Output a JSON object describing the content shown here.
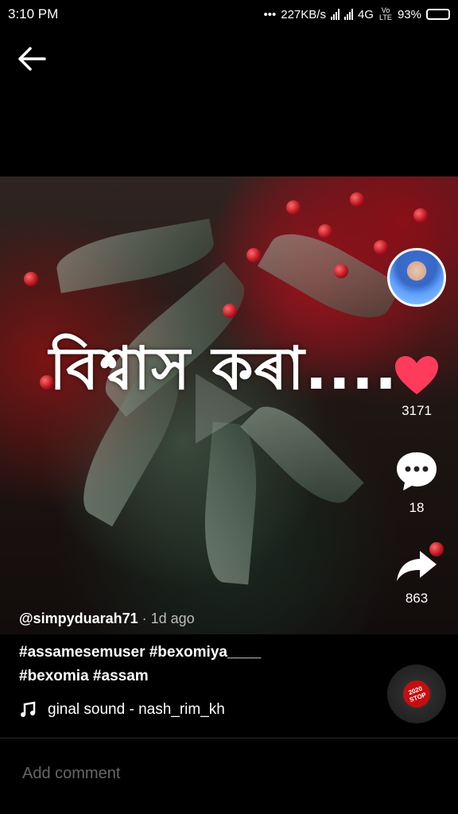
{
  "status_bar": {
    "time": "3:10 PM",
    "net_speed": "227KB/s",
    "network": "4G",
    "volte": "Vo LTE",
    "battery_percent": "93%",
    "battery_level": 0.93
  },
  "video": {
    "overlay_text": "বিশ্বাস কৰা....",
    "author": "@simpyduarah71",
    "posted": "· 1d ago",
    "caption_line1": "#assamesemuser #bexomiya____",
    "caption_line2": "#bexomia #assam",
    "sound": "ginal sound - nash_rim_kh"
  },
  "actions": {
    "likes": "3171",
    "comments": "18",
    "shares": "863"
  },
  "disc": {
    "year": "2020",
    "label": "STOP"
  },
  "comment": {
    "placeholder": "Add comment"
  },
  "colors": {
    "like": "#ff3b5c",
    "disc_center": "#c40e12"
  }
}
